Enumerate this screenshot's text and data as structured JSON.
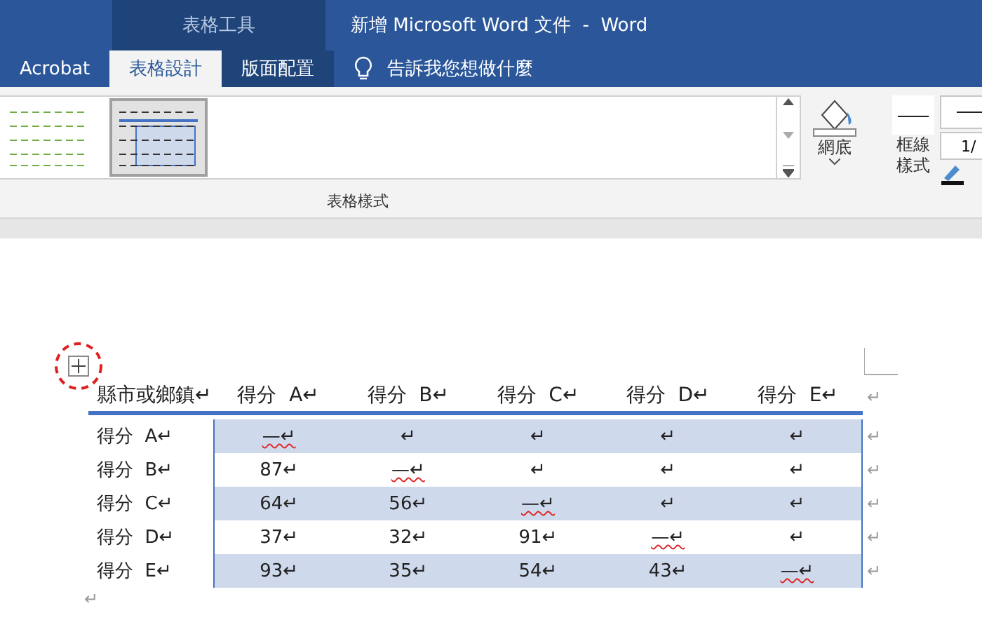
{
  "window": {
    "context_tab": "表格工具",
    "title": "新增 Microsoft Word 文件  -  Word"
  },
  "tabs": [
    {
      "label": "Acrobat",
      "selected": false
    },
    {
      "label": "表格設計",
      "selected": true
    },
    {
      "label": "版面配置",
      "selected": false
    }
  ],
  "tell_me": {
    "placeholder": "告訴我您想做什麼"
  },
  "ribbon": {
    "styles": [
      {
        "kind": "green",
        "selected": false
      },
      {
        "kind": "blue",
        "selected": true
      }
    ],
    "group_label": "表格樣式",
    "shading_label": "網底",
    "border_style_label": [
      "框線",
      "樣式"
    ],
    "weight_value": "1/"
  },
  "table": {
    "columns": [
      "縣市或鄉鎮↵",
      "得分  A↵",
      "得分  B↵",
      "得分  C↵",
      "得分  D↵",
      "得分  E↵"
    ],
    "header_end": "↵",
    "rows": [
      {
        "cells": [
          {
            "text": "得分  A↵"
          },
          {
            "text": "—↵",
            "spell_error": true
          },
          {
            "text": "↵"
          },
          {
            "text": "↵"
          },
          {
            "text": "↵"
          },
          {
            "text": "↵"
          }
        ],
        "end": "↵",
        "shaded": true
      },
      {
        "cells": [
          {
            "text": "得分  B↵"
          },
          {
            "text": "87↵"
          },
          {
            "text": "—↵",
            "spell_error": true
          },
          {
            "text": "↵"
          },
          {
            "text": "↵"
          },
          {
            "text": "↵"
          }
        ],
        "end": "↵",
        "shaded": false
      },
      {
        "cells": [
          {
            "text": "得分  C↵"
          },
          {
            "text": "64↵"
          },
          {
            "text": "56↵"
          },
          {
            "text": "—↵",
            "spell_error": true
          },
          {
            "text": "↵"
          },
          {
            "text": "↵"
          }
        ],
        "end": "↵",
        "shaded": true
      },
      {
        "cells": [
          {
            "text": "得分  D↵"
          },
          {
            "text": "37↵"
          },
          {
            "text": "32↵"
          },
          {
            "text": "91↵"
          },
          {
            "text": "—↵",
            "spell_error": true
          },
          {
            "text": "↵"
          }
        ],
        "end": "↵",
        "shaded": false
      },
      {
        "cells": [
          {
            "text": "得分  E↵"
          },
          {
            "text": "93↵"
          },
          {
            "text": "35↵"
          },
          {
            "text": "54↵"
          },
          {
            "text": "43↵"
          },
          {
            "text": "—↵",
            "spell_error": true
          }
        ],
        "end": "↵",
        "shaded": true
      }
    ]
  },
  "after_table": "↵"
}
